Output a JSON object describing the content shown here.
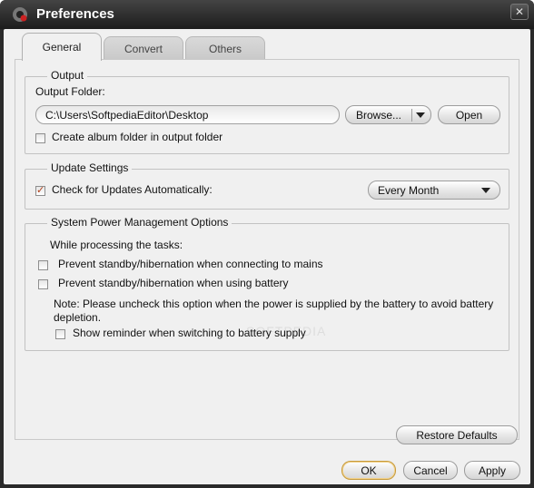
{
  "window": {
    "title": "Preferences",
    "close_glyph": "✕",
    "app_icon": "record-icon"
  },
  "tabs": [
    {
      "label": "General",
      "active": true
    },
    {
      "label": "Convert",
      "active": false
    },
    {
      "label": "Others",
      "active": false
    }
  ],
  "output": {
    "legend": "Output",
    "folder_label": "Output Folder:",
    "folder_value": "C:\\Users\\SoftpediaEditor\\Desktop",
    "browse_label": "Browse...",
    "open_label": "Open",
    "album_folder_label": "Create album folder in output folder",
    "album_folder_checked": false
  },
  "update": {
    "legend": "Update Settings",
    "check_label": "Check for Updates Automatically:",
    "check_checked": true,
    "frequency_value": "Every Month"
  },
  "power": {
    "legend": "System Power Management Options",
    "while_label": "While processing the tasks:",
    "prevent_mains_label": "Prevent standby/hibernation when connecting to mains",
    "prevent_mains_checked": false,
    "prevent_battery_label": "Prevent standby/hibernation when using battery",
    "prevent_battery_checked": false,
    "note_line1": "Note: Please uncheck this option when the power is supplied by the battery to avoid battery",
    "note_line2": "depletion.",
    "reminder_label": "Show reminder when switching to battery supply",
    "reminder_checked": false
  },
  "buttons": {
    "restore_defaults": "Restore Defaults",
    "ok": "OK",
    "cancel": "Cancel",
    "apply": "Apply"
  },
  "colors": {
    "titlebar": "#1c1c1c",
    "client_bg": "#f0f0f0",
    "check_mark": "#b0401a",
    "ok_border": "#c79a3a"
  }
}
